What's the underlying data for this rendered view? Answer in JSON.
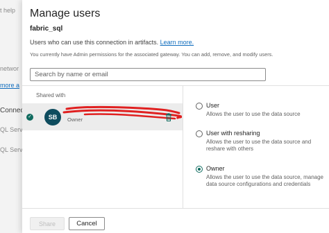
{
  "background": {
    "fragments": [
      "t help",
      "networ",
      "more a",
      "Connec",
      "QL Serv",
      "QL Serv"
    ]
  },
  "dialog": {
    "title": "Manage users",
    "connection_name": "fabric_sql",
    "description": "Users who can use this connection in artifacts.",
    "learn_more": "Learn more.",
    "admin_note": "You currently have Admin permissions for the associated gateway. You can add, remove, and modify users.",
    "search_placeholder": "Search by name or email",
    "shared_with_label": "Shared with",
    "user": {
      "initials": "SB",
      "role": "Owner",
      "avatar_color": "#0e4c5e",
      "name_redacted": true
    },
    "options": [
      {
        "label": "User",
        "description": "Allows the user to use the data source",
        "selected": false
      },
      {
        "label": "User with resharing",
        "description": "Allows the user to use the data source and reshare with others",
        "selected": false
      },
      {
        "label": "Owner",
        "description": "Allows the user to use the data source, manage data source configurations and credentials",
        "selected": true
      }
    ],
    "share_button": "Share",
    "cancel_button": "Cancel"
  },
  "colors": {
    "accent": "#0e6b5f",
    "link": "#0f6cbd",
    "redaction": "#e02020"
  }
}
